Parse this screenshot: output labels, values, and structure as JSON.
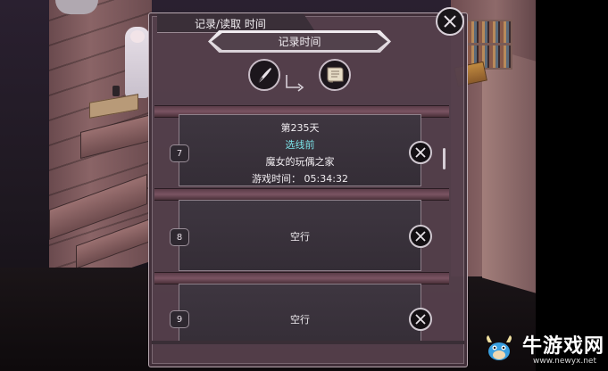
{
  "dialog": {
    "tab_title": "记录/读取 时间",
    "header": "记录时间",
    "mode_icons": [
      "quill-pen-icon",
      "parchment-scroll-icon"
    ]
  },
  "slots": [
    {
      "number": "7",
      "day": "第235天",
      "chapter": "选线前",
      "location": "魔女的玩偶之家",
      "playtime": "游戏时间： 05:34:32"
    },
    {
      "number": "8",
      "label": "空行"
    },
    {
      "number": "9",
      "label": "空行"
    }
  ],
  "watermark": {
    "name": "牛游戏网",
    "url": "www.newyx.net"
  },
  "colors": {
    "panel": "#58424e",
    "slot_bg": "#3e3640",
    "accent_cyan": "#7ae0e6",
    "beam": "#7a5462"
  }
}
